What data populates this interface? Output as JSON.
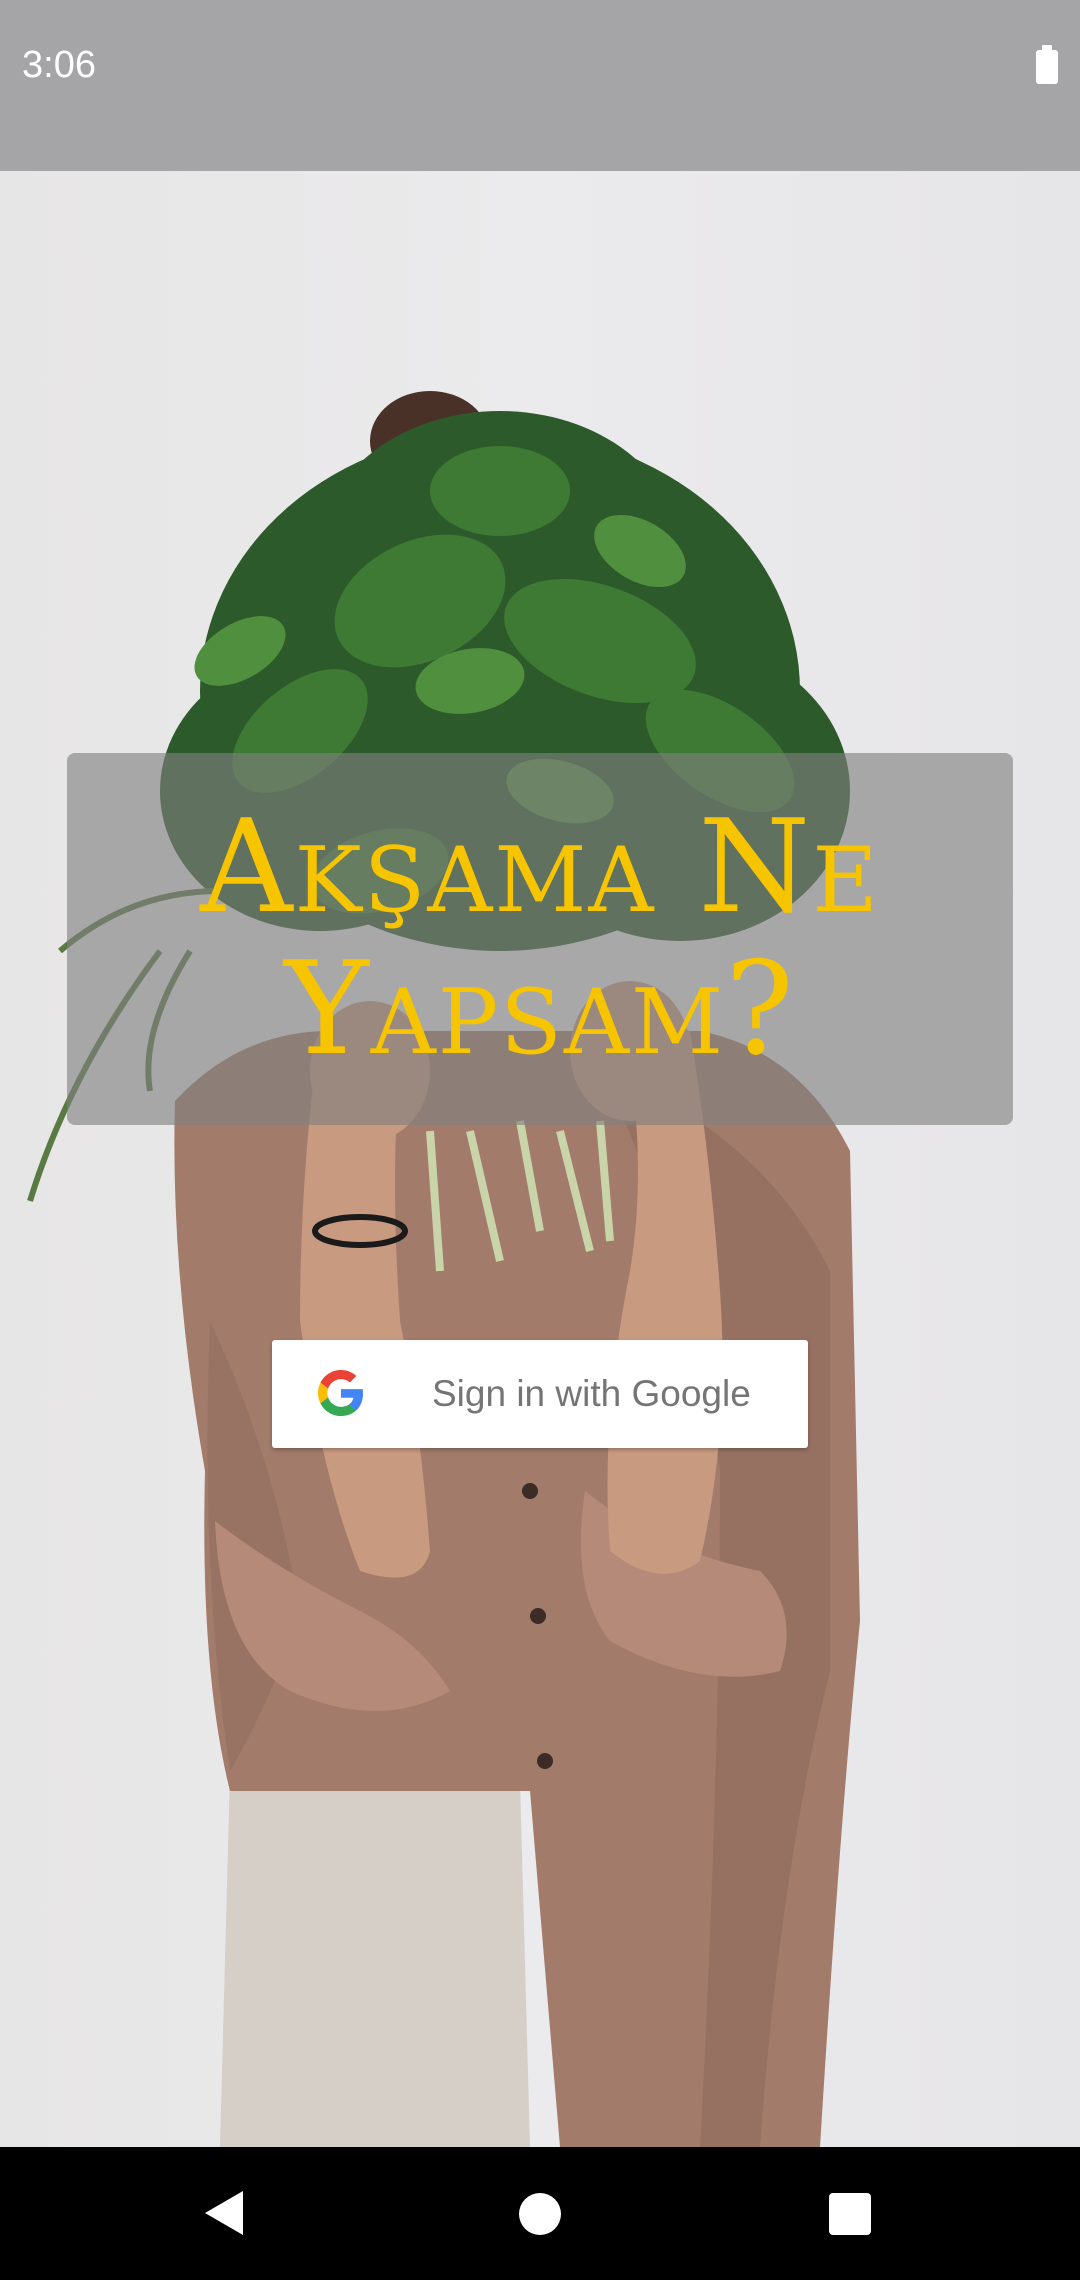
{
  "status_bar": {
    "time": "3:06",
    "battery_icon": "battery-full-icon"
  },
  "background": {
    "description_icon": "food-photo"
  },
  "title": {
    "text": "Akşama Ne Yapsam?",
    "color": "#f7c400"
  },
  "sign_in": {
    "label": "Sign in with Google",
    "icon": "google-g-icon"
  },
  "nav_bar": {
    "back_icon": "back-triangle-icon",
    "home_icon": "home-circle-icon",
    "recents_icon": "recents-square-icon"
  }
}
